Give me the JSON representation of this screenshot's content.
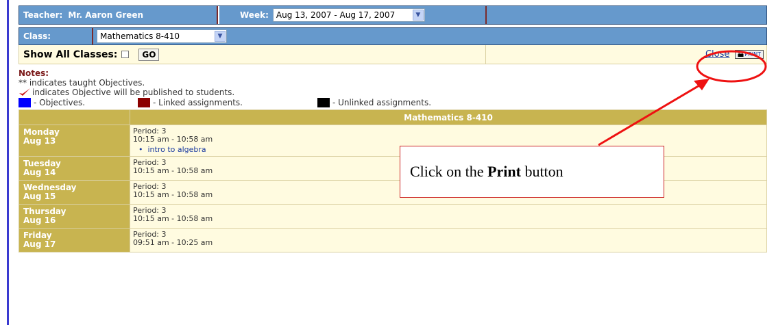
{
  "teacher": {
    "label": "Teacher:",
    "name": "Mr. Aaron Green"
  },
  "week": {
    "label": "Week:",
    "selected": "Aug 13, 2007 - Aug 17, 2007"
  },
  "class": {
    "label": "Class:",
    "selected": "Mathematics 8-410"
  },
  "showall": {
    "label": "Show All Classes:",
    "go_label": "GO"
  },
  "actions": {
    "close_label": "Close",
    "print_label": "PRINT"
  },
  "notes": {
    "title": "Notes:",
    "line1": "** indicates taught Objectives.",
    "line2": "indicates Objective will be published to students.",
    "legend": [
      {
        "label": "- Objectives.",
        "color": "#0000ff"
      },
      {
        "label": "- Linked assignments.",
        "color": "#8b0000"
      },
      {
        "label": "- Unlinked assignments.",
        "color": "#000000"
      }
    ]
  },
  "schedule": {
    "header": "Mathematics 8-410",
    "rows": [
      {
        "day": "Monday",
        "date": "Aug 13",
        "period": "Period: 3",
        "time": "10:15 am - 10:58 am",
        "objective": "intro to algebra"
      },
      {
        "day": "Tuesday",
        "date": "Aug 14",
        "period": "Period: 3",
        "time": "10:15 am - 10:58 am"
      },
      {
        "day": "Wednesday",
        "date": "Aug 15",
        "period": "Period: 3",
        "time": "10:15 am - 10:58 am"
      },
      {
        "day": "Thursday",
        "date": "Aug 16",
        "period": "Period: 3",
        "time": "10:15 am - 10:58 am"
      },
      {
        "day": "Friday",
        "date": "Aug 17",
        "period": "Period: 3",
        "time": "09:51 am - 10:25 am"
      }
    ]
  },
  "callout": {
    "prefix": "Click on the ",
    "bold": "Print",
    "suffix": " button"
  },
  "colors": {
    "header_blue": "#6699cc",
    "tan": "#c8b450",
    "light_tan": "#fffbe0",
    "annotation_red": "#ee1111"
  }
}
